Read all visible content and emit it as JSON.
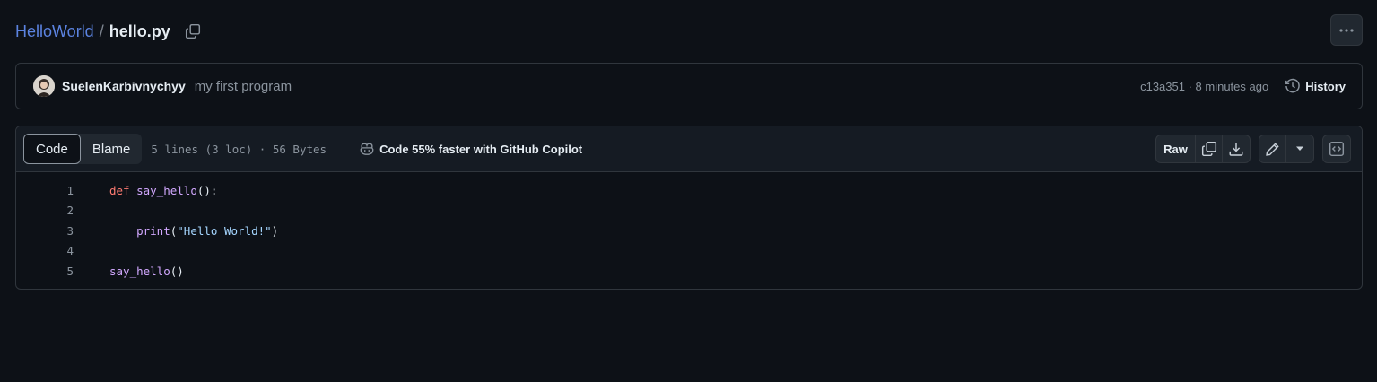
{
  "breadcrumb": {
    "repo": "HelloWorld",
    "separator": "/",
    "file": "hello.py"
  },
  "commit": {
    "author": "SuelenKarbivnychyy",
    "message": "my first program",
    "meta": "c13a351 · 8 minutes ago",
    "history_label": "History"
  },
  "file_header": {
    "tabs": [
      {
        "label": "Code",
        "active": true
      },
      {
        "label": "Blame",
        "active": false
      }
    ],
    "info": "5 lines (3 loc) · 56 Bytes",
    "copilot_label": "Code 55% faster with GitHub Copilot",
    "raw_label": "Raw"
  },
  "code": {
    "lines": [
      {
        "number": "1",
        "tokens": [
          {
            "t": "def",
            "c": "kw"
          },
          {
            "t": " ",
            "c": "plain"
          },
          {
            "t": "say_hello",
            "c": "fn"
          },
          {
            "t": "():",
            "c": "plain"
          }
        ]
      },
      {
        "number": "2",
        "tokens": []
      },
      {
        "number": "3",
        "tokens": [
          {
            "t": "    ",
            "c": "plain"
          },
          {
            "t": "print",
            "c": "fn"
          },
          {
            "t": "(",
            "c": "plain"
          },
          {
            "t": "\"Hello World!\"",
            "c": "str"
          },
          {
            "t": ")",
            "c": "plain"
          }
        ]
      },
      {
        "number": "4",
        "tokens": []
      },
      {
        "number": "5",
        "tokens": [
          {
            "t": "say_hello",
            "c": "fn"
          },
          {
            "t": "()",
            "c": "plain"
          }
        ]
      }
    ]
  },
  "colors": {
    "background": "#0d1117",
    "link": "#5b83e0",
    "keyword": "#ff7b72",
    "function": "#d2a8ff",
    "string": "#a5d6ff",
    "muted": "#8b949e"
  },
  "icons": {
    "copy_path": "copy-icon",
    "more": "kebab-horizontal-icon",
    "history": "history-icon",
    "copilot": "copilot-icon",
    "copy_raw": "copy-icon",
    "download": "download-icon",
    "edit": "pencil-icon",
    "caret": "triangle-down-icon",
    "symbols": "code-square-icon"
  }
}
